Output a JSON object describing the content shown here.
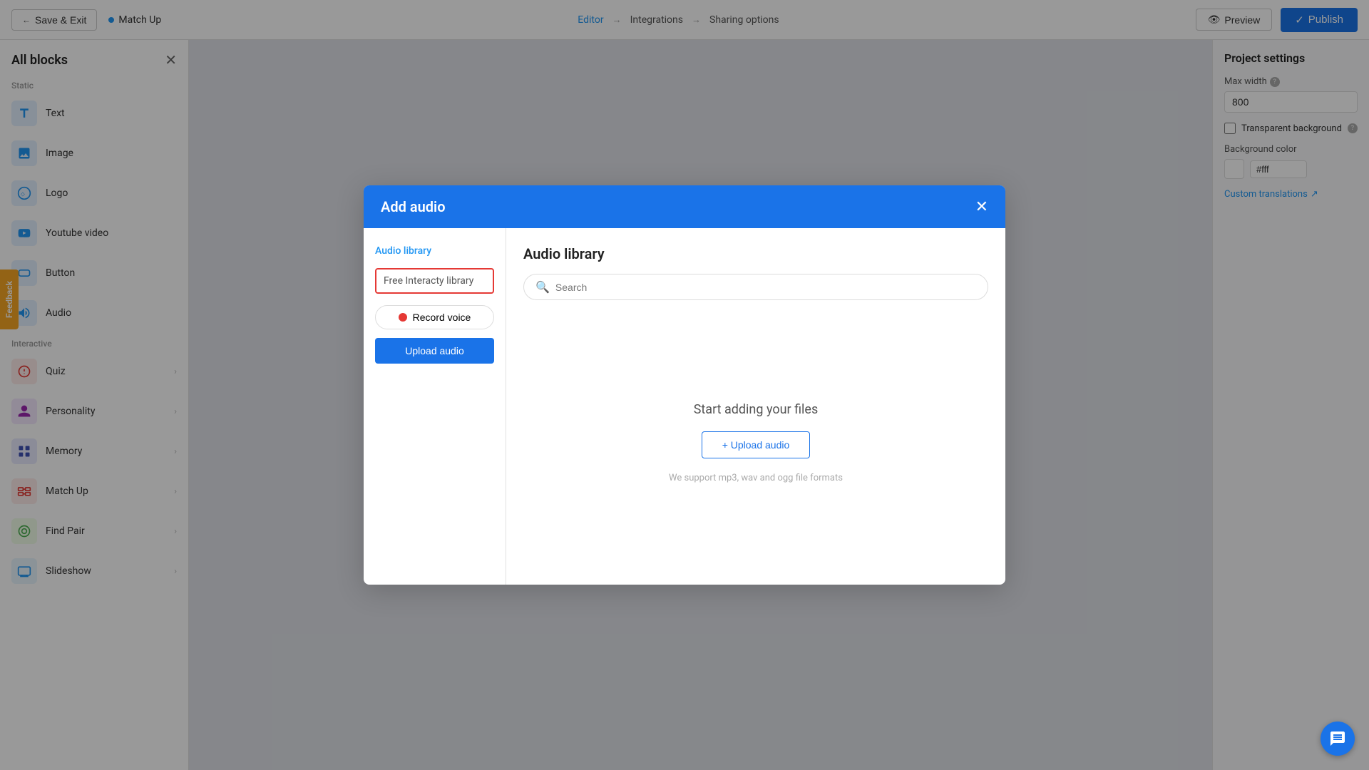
{
  "topbar": {
    "save_exit_label": "Save & Exit",
    "current_page_label": "Match Up",
    "nav_editor": "Editor",
    "nav_integrations": "Integrations",
    "nav_sharing": "Sharing options",
    "preview_label": "Preview",
    "publish_label": "Publish"
  },
  "sidebar": {
    "title": "All blocks",
    "section_static": "Static",
    "section_interactive": "Interactive",
    "items_static": [
      {
        "label": "Text",
        "icon": "text"
      },
      {
        "label": "Image",
        "icon": "image"
      },
      {
        "label": "Logo",
        "icon": "logo"
      },
      {
        "label": "Youtube video",
        "icon": "youtube"
      },
      {
        "label": "Button",
        "icon": "button"
      },
      {
        "label": "Audio",
        "icon": "audio"
      }
    ],
    "items_interactive": [
      {
        "label": "Quiz",
        "icon": "quiz"
      },
      {
        "label": "Personality",
        "icon": "personality"
      },
      {
        "label": "Memory",
        "icon": "memory"
      },
      {
        "label": "Match Up",
        "icon": "matchup"
      },
      {
        "label": "Find Pair",
        "icon": "findpair"
      },
      {
        "label": "Slideshow",
        "icon": "slideshow"
      }
    ]
  },
  "feedback": {
    "label": "Feedback"
  },
  "right_panel": {
    "title": "Project settings",
    "max_width_label": "Max width",
    "max_width_value": "800",
    "transparent_bg_label": "Transparent background",
    "bg_color_label": "Background color",
    "bg_color_value": "#fff",
    "custom_translations_label": "Custom translations"
  },
  "modal": {
    "title": "Add audio",
    "nav_audio_library": "Audio library",
    "nav_free_library": "Free Interacty library",
    "record_label": "Record voice",
    "upload_label": "Upload audio",
    "section_title": "Audio library",
    "search_placeholder": "Search",
    "empty_title": "Start adding your files",
    "upload_btn_label": "+ Upload audio",
    "format_hint": "We support mp3, wav and ogg file formats"
  }
}
